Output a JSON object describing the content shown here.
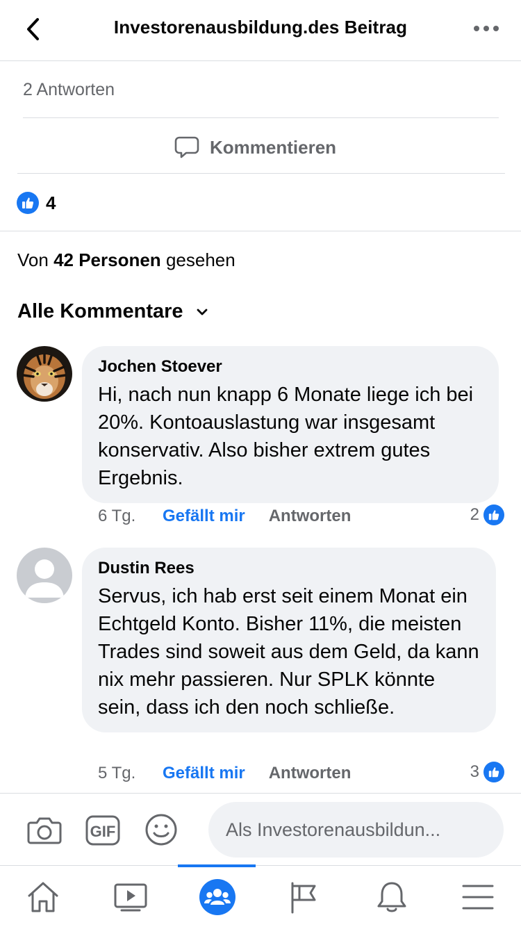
{
  "header": {
    "title": "Investorenausbildung.des Beitrag"
  },
  "post": {
    "replies_label": "2 Antworten",
    "comment_action_label": "Kommentieren",
    "likes_count": "4",
    "seen_prefix": "Von",
    "seen_count": "42 Personen",
    "seen_suffix": "gesehen",
    "comments_filter_label": "Alle Kommentare"
  },
  "comments": [
    {
      "author": "Jochen Stoever",
      "text": "Hi, nach nun knapp 6 Monate liege ich bei 20%. Kontoauslastung war insgesamt konservativ. Also bisher extrem gutes Ergebnis.",
      "time": "6 Tg.",
      "like_label": "Gefällt mir",
      "reply_label": "Antworten",
      "reactions": "2"
    },
    {
      "author": "Dustin Rees",
      "text": "Servus, ich hab erst seit einem Monat ein Echtgeld Konto. Bisher 11%, die meisten Trades sind soweit aus dem Geld, da kann nix mehr passieren. Nur SPLK könnte sein, dass ich den noch schließe.",
      "time": "5 Tg.",
      "like_label": "Gefällt mir",
      "reply_label": "Antworten",
      "reactions": "3"
    }
  ],
  "composer": {
    "placeholder": "Als Investorenausbildun...",
    "gif_label": "GIF"
  },
  "tabbar": {
    "items": [
      "home-icon",
      "video-icon",
      "groups-icon",
      "pages-flag-icon",
      "notifications-bell-icon",
      "menu-icon"
    ],
    "active": "groups-icon"
  },
  "colors": {
    "accent": "#1877f2",
    "secondary_text": "#65676b",
    "bubble": "#f0f2f5",
    "divider": "#dadde1"
  }
}
